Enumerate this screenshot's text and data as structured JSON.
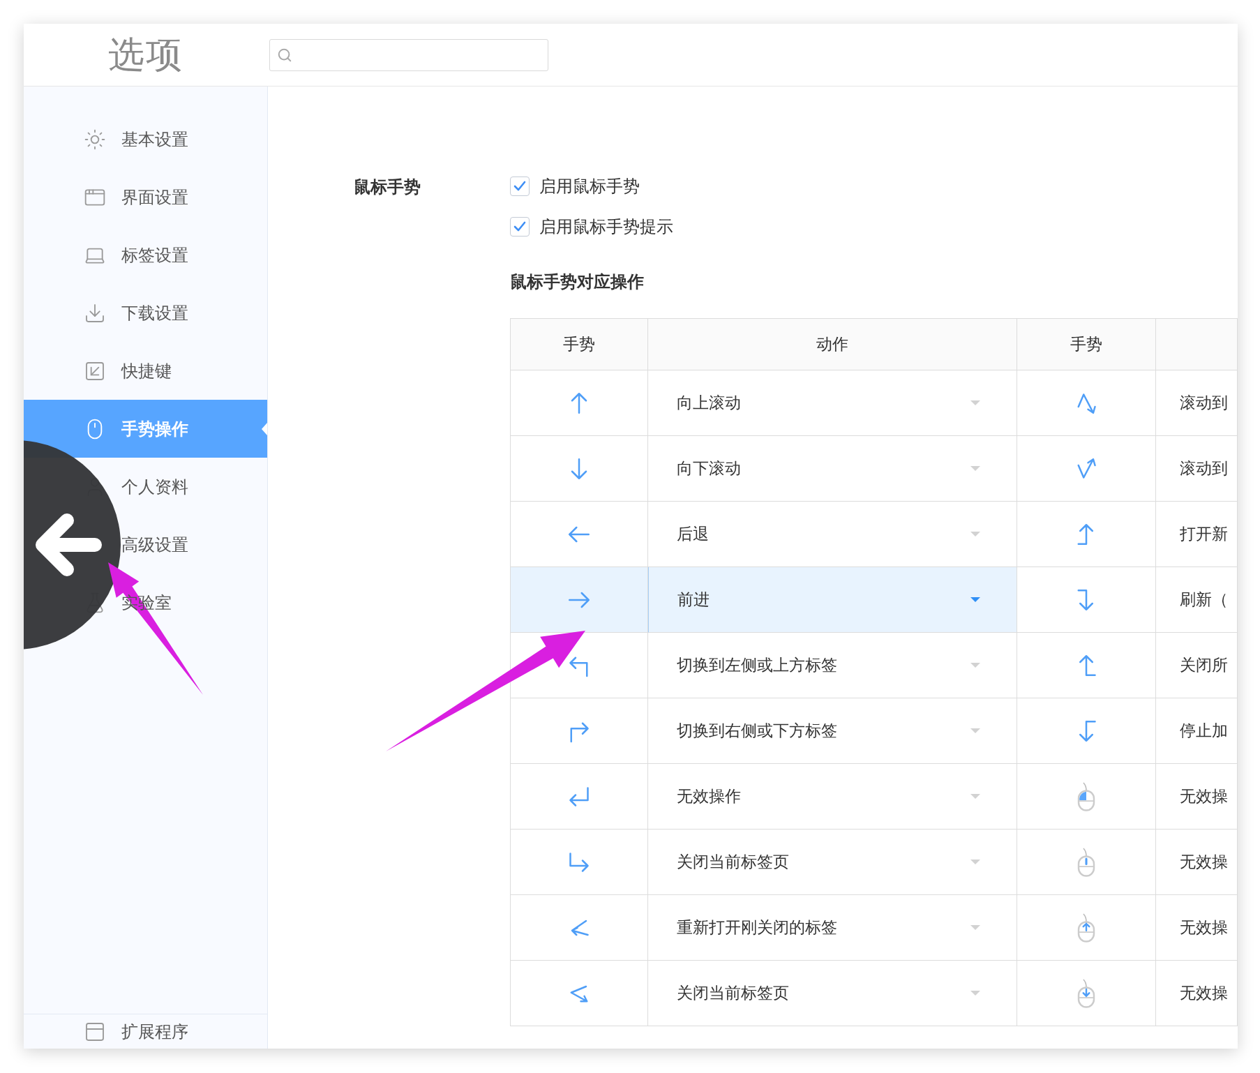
{
  "window": {
    "title": "选项"
  },
  "sidebar": {
    "items": [
      {
        "label": "基本设置",
        "selected": false
      },
      {
        "label": "界面设置",
        "selected": false
      },
      {
        "label": "标签设置",
        "selected": false
      },
      {
        "label": "下载设置",
        "selected": false
      },
      {
        "label": "快捷键",
        "selected": false
      },
      {
        "label": "手势操作",
        "selected": true
      },
      {
        "label": "个人资料",
        "selected": false
      },
      {
        "label": "高级设置",
        "selected": false
      },
      {
        "label": "实验室",
        "selected": false
      }
    ],
    "footer_item": "扩展程序"
  },
  "mouse_gestures": {
    "label": "鼠标手势",
    "options": [
      {
        "label": "启用鼠标手势",
        "checked": true
      },
      {
        "label": "启用鼠标手势提示",
        "checked": true
      }
    ],
    "mapping_title": "鼠标手势对应操作"
  },
  "table": {
    "columns": [
      "手势",
      "动作",
      "手势"
    ],
    "rows": [
      {
        "action": "向上滚动",
        "column_4": "滚动到",
        "selected": false
      },
      {
        "action": "向下滚动",
        "column_4": "滚动到",
        "selected": false
      },
      {
        "action": "后退",
        "column_4": "打开新",
        "selected": false
      },
      {
        "action": "前进",
        "column_4": "刷新（",
        "selected": true
      },
      {
        "action": "切换到左侧或上方标签",
        "column_4": "关闭所",
        "selected": false
      },
      {
        "action": "切换到右侧或下方标签",
        "column_4": "停止加",
        "selected": false
      },
      {
        "action": "无效操作",
        "column_4": "无效操",
        "selected": false
      },
      {
        "action": "关闭当前标签页",
        "column_4": "无效操",
        "selected": false
      },
      {
        "action": "重新打开刚关闭的标签",
        "column_4": "无效操",
        "selected": false
      },
      {
        "action": "关闭当前标签页",
        "column_4": "无效操",
        "selected": false
      }
    ]
  }
}
